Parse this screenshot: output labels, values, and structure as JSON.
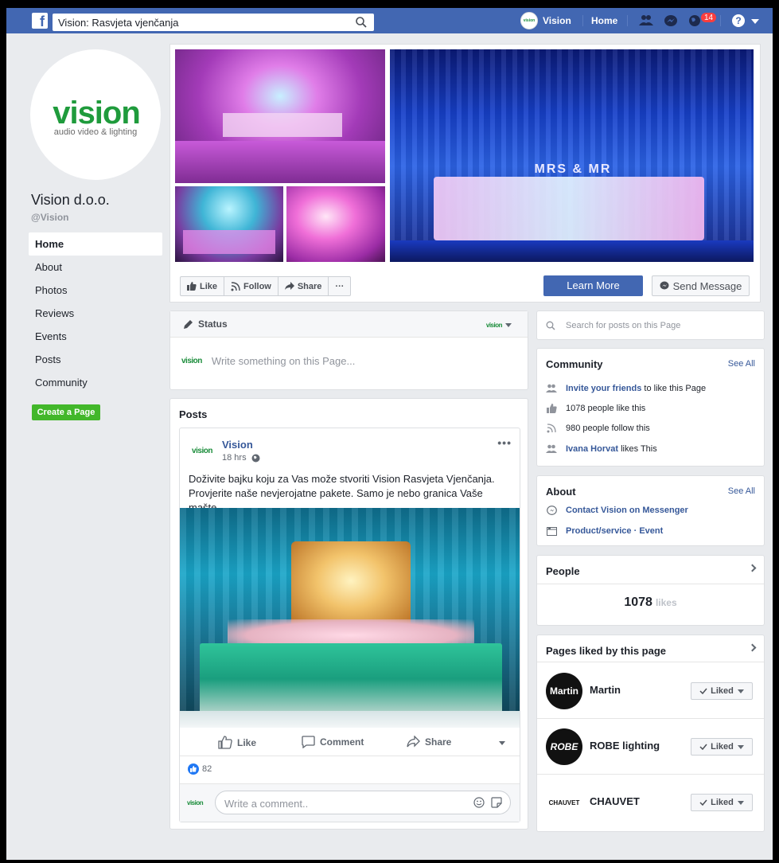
{
  "topbar": {
    "search_value": "Vision: Rasvjeta vjenčanja",
    "profile_name": "Vision",
    "home_label": "Home",
    "notification_count": "14",
    "help_glyph": "?",
    "brand_color": "#4267b2"
  },
  "page": {
    "logo_word": "vision",
    "logo_tagline": "audio video & lighting",
    "name": "Vision d.o.o.",
    "handle": "@Vision"
  },
  "sidebar": {
    "items": [
      {
        "label": "Home",
        "active": true
      },
      {
        "label": "About"
      },
      {
        "label": "Photos"
      },
      {
        "label": "Reviews"
      },
      {
        "label": "Events"
      },
      {
        "label": "Posts"
      },
      {
        "label": "Community"
      }
    ],
    "create_page_label": "Create a Page"
  },
  "cover": {
    "like_label": "Like",
    "follow_label": "Follow",
    "share_label": "Share",
    "more_label": "···",
    "learn_more_label": "Learn More",
    "send_message_label": "Send Message",
    "banner_text": "MRS & MR"
  },
  "status": {
    "label": "Status",
    "avatar_label": "vision",
    "placeholder": "Write something on this Page..."
  },
  "posts": {
    "title": "Posts",
    "post": {
      "author": "Vision",
      "avatar_label": "vision",
      "time": "18 hrs",
      "text": "Doživite bajku koju za Vas može stvoriti Vision Rasvjeta Vjenčanja. Provjerite naše nevjerojatne pakete. Samo je nebo granica Vaše mašte.",
      "like_label": "Like",
      "comment_label": "Comment",
      "share_label": "Share",
      "reaction_count": "82",
      "comment_placeholder": "Write a comment.."
    }
  },
  "right": {
    "search_placeholder": "Search for posts on this Page",
    "community": {
      "title": "Community",
      "see_all": "See All",
      "invite_link": "Invite your friends",
      "invite_rest": " to like this Page",
      "likes_text": "1078 people like this",
      "follows_text": "980 people follow this",
      "friend_name": "Ivana Horvat",
      "friend_rest": " likes This"
    },
    "about": {
      "title": "About",
      "see_all": "See All",
      "messenger": "Contact Vision on Messenger",
      "category": "Product/service · Event"
    },
    "people": {
      "title": "People",
      "count": "1078",
      "count_label": "likes"
    },
    "liked_pages": {
      "title": "Pages liked by this page",
      "button_label": "Liked",
      "items": [
        {
          "name": "Martin",
          "logo": "Martin"
        },
        {
          "name": "ROBE lighting",
          "logo": "ROBE"
        },
        {
          "name": "CHAUVET",
          "logo": "CHAUVET"
        }
      ]
    }
  }
}
